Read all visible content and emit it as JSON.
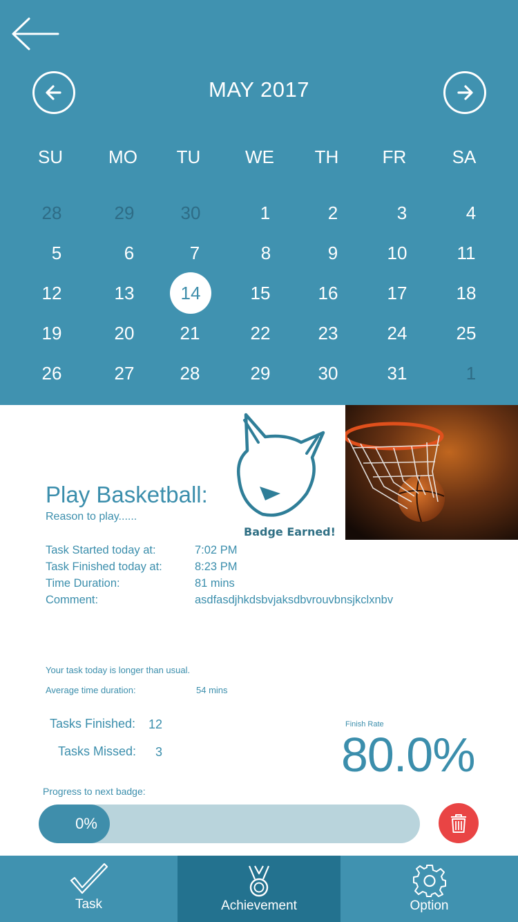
{
  "header": {
    "back_icon": "arrow-left-icon",
    "month_title": "MAY 2017",
    "prev_icon": "chevron-left-circle-icon",
    "next_icon": "chevron-right-circle-icon"
  },
  "calendar": {
    "weekdays": [
      "SU",
      "MO",
      "TU",
      "WE",
      "TH",
      "FR",
      "SA"
    ],
    "weeks": [
      [
        "28",
        "29",
        "30",
        "1",
        "2",
        "3",
        "4"
      ],
      [
        "5",
        "6",
        "7",
        "8",
        "9",
        "10",
        "11"
      ],
      [
        "12",
        "13",
        "14",
        "15",
        "16",
        "17",
        "18"
      ],
      [
        "19",
        "20",
        "21",
        "22",
        "23",
        "24",
        "25"
      ],
      [
        "26",
        "27",
        "28",
        "29",
        "30",
        "31",
        "1"
      ]
    ],
    "selected_day": "14"
  },
  "badge": {
    "icon": "fox-badge-icon",
    "label": "Badge Earned!"
  },
  "photo": {
    "icon": "basketball-hoop-photo"
  },
  "task": {
    "title": "Play Basketball:",
    "reason": "Reason to play......",
    "started_label": "Task Started today at:",
    "started_value": "7:02 PM",
    "finished_label": "Task Finished today at:",
    "finished_value": "8:23 PM",
    "duration_label": "Time Duration:",
    "duration_value": "81 mins",
    "comment_label": "Comment:",
    "comment_value": "asdfasdjhkdsbvjaksdbvrouvbnsjkclxnbv"
  },
  "summary": {
    "note": "Your task today is longer than usual.",
    "avg_label": "Average time duration:",
    "avg_value": "54 mins"
  },
  "stats": {
    "finished_label": "Tasks Finished:",
    "finished_value": "12",
    "missed_label": "Tasks Missed:",
    "missed_value": "3",
    "rate_label": "Finish Rate",
    "rate_value": "80.0%"
  },
  "progress": {
    "label": "Progress to next badge:",
    "value_text": "0%",
    "fraction": 0.0,
    "delete_icon": "trash-icon"
  },
  "tabs": [
    {
      "label": "Task",
      "icon": "checkmark-icon"
    },
    {
      "label": "Achievement",
      "icon": "medal-icon",
      "active": true
    },
    {
      "label": "Option",
      "icon": "gear-icon"
    }
  ],
  "colors": {
    "primary": "#4092b0",
    "active_tab": "#23728f",
    "text_accent": "#3b8eac",
    "progress_track": "#b9d4dc",
    "delete": "#e94444"
  }
}
